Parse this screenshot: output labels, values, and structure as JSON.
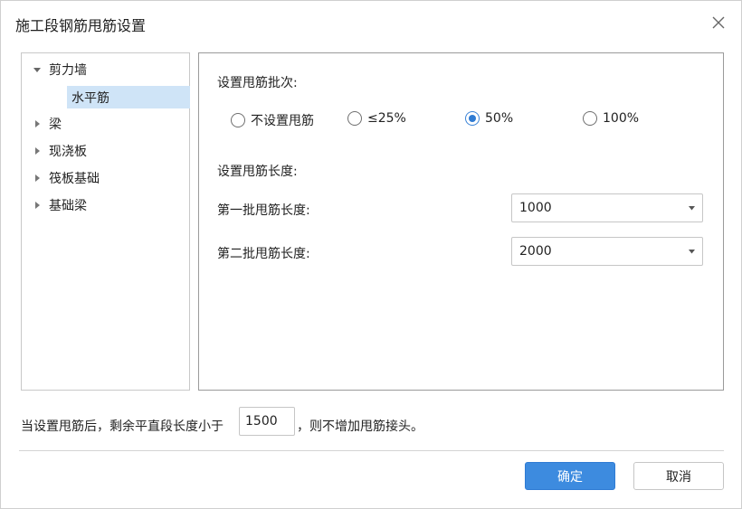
{
  "dialog": {
    "title": "施工段钢筋甩筋设置",
    "close_icon": "close-icon"
  },
  "tree": {
    "items": [
      {
        "label": "剪力墙",
        "expanded": true,
        "children": [
          {
            "label": "水平筋",
            "selected": true
          }
        ]
      },
      {
        "label": "梁",
        "expanded": false
      },
      {
        "label": "现浇板",
        "expanded": false
      },
      {
        "label": "筏板基础",
        "expanded": false
      },
      {
        "label": "基础梁",
        "expanded": false
      }
    ]
  },
  "panel": {
    "batch_label": "设置甩筋批次:",
    "batch_options": [
      {
        "label": "不设置甩筋",
        "checked": false
      },
      {
        "label": "≤25%",
        "checked": false
      },
      {
        "label": "50%",
        "checked": true
      },
      {
        "label": "100%",
        "checked": false
      }
    ],
    "length_label": "设置甩筋长度:",
    "first_label": "第一批甩筋长度:",
    "first_value": "1000",
    "second_label": "第二批甩筋长度:",
    "second_value": "2000"
  },
  "footer": {
    "text_before": "当设置甩筋后，剩余平直段长度小于",
    "threshold": "1500",
    "text_after": "，则不增加甩筋接头。",
    "ok_label": "确定",
    "cancel_label": "取消"
  },
  "colors": {
    "accent": "#3d8bdf",
    "selection": "#cfe4f7"
  }
}
